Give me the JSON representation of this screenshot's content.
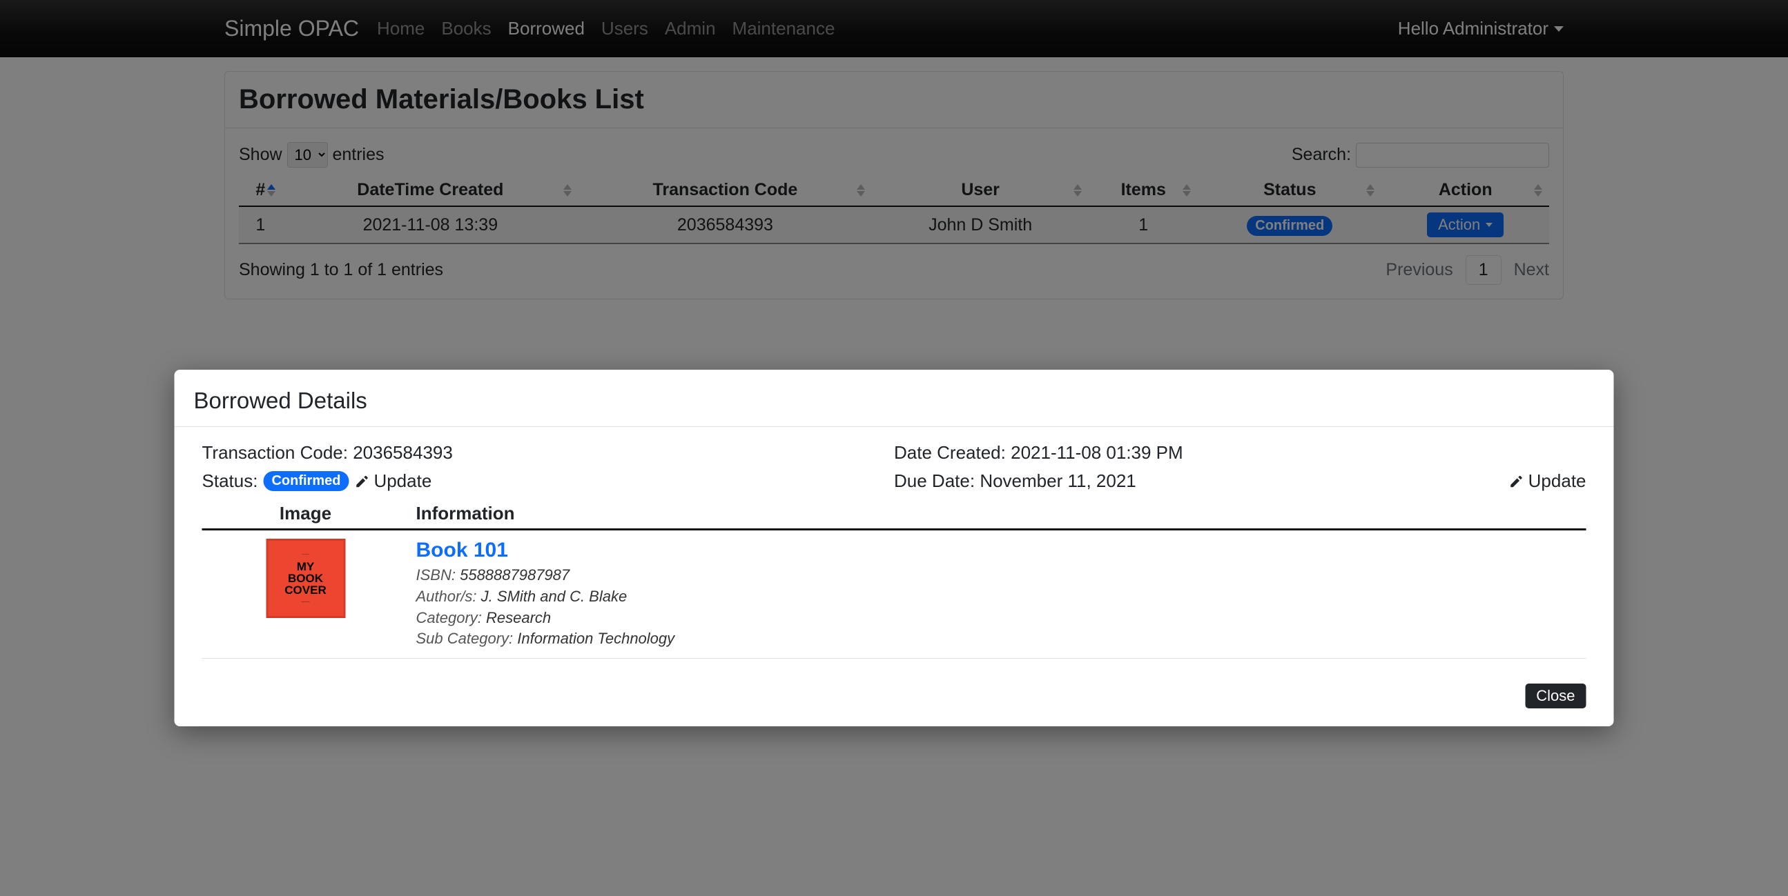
{
  "brand": "Simple OPAC",
  "nav": {
    "items": [
      {
        "label": "Home",
        "active": false
      },
      {
        "label": "Books",
        "active": false
      },
      {
        "label": "Borrowed",
        "active": true
      },
      {
        "label": "Users",
        "active": false
      },
      {
        "label": "Admin",
        "active": false
      },
      {
        "label": "Maintenance",
        "active": false
      }
    ],
    "user_greeting": "Hello Administrator"
  },
  "page": {
    "title": "Borrowed Materials/Books List",
    "datatable": {
      "length_prefix": "Show",
      "length_value": "10",
      "length_suffix": "entries",
      "search_label": "Search:",
      "search_value": "",
      "columns": [
        "#",
        "DateTime Created",
        "Transaction Code",
        "User",
        "Items",
        "Status",
        "Action"
      ],
      "rows": [
        {
          "index": "1",
          "datetime": "2021-11-08 13:39",
          "code": "2036584393",
          "user": "John D Smith",
          "items": "1",
          "status": "Confirmed",
          "action_label": "Action"
        }
      ],
      "info": "Showing 1 to 1 of 1 entries",
      "prev": "Previous",
      "page": "1",
      "next": "Next"
    }
  },
  "modal": {
    "title": "Borrowed Details",
    "txn_code_label": "Transaction Code:",
    "txn_code": "2036584393",
    "date_created_label": "Date Created:",
    "date_created": "2021-11-08 01:39 PM",
    "status_label": "Status:",
    "status": "Confirmed",
    "update_label": "Update",
    "due_date_label": "Due Date:",
    "due_date": "November 11, 2021",
    "columns": {
      "image": "Image",
      "information": "Information"
    },
    "book": {
      "cover_text": "MY BOOK COVER",
      "title": "Book 101",
      "isbn_label": "ISBN:",
      "isbn": "5588887987987",
      "authors_label": "Author/s:",
      "authors": "J. SMith and C. Blake",
      "category_label": "Category:",
      "category": "Research",
      "subcategory_label": "Sub Category:",
      "subcategory": "Information Technology"
    },
    "close": "Close"
  }
}
